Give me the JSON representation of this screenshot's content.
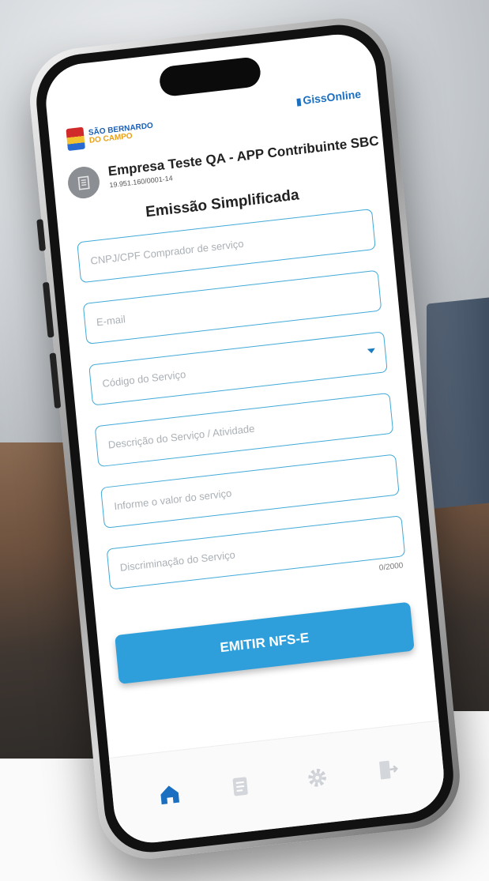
{
  "header": {
    "city_logo": {
      "line1": "SÃO BERNARDO",
      "line2": "DO CAMPO"
    },
    "app_logo": "GissOnline"
  },
  "company": {
    "name": "Empresa Teste QA - APP Contribuinte SBC",
    "document": "19.951.160/0001-14"
  },
  "form": {
    "title": "Emissão Simplificada",
    "fields": [
      {
        "placeholder": "CNPJ/CPF Comprador de serviço"
      },
      {
        "placeholder": "E-mail"
      },
      {
        "placeholder": "Código do Serviço",
        "type": "select"
      },
      {
        "placeholder": "Descrição do Serviço / Atividade"
      },
      {
        "placeholder": "Informe o valor do serviço"
      },
      {
        "placeholder": "Discriminação do Serviço",
        "counter": "0/2000"
      }
    ],
    "submit_label": "EMITIR NFS-E"
  },
  "bottom_nav": {
    "items": [
      {
        "icon": "home-icon",
        "active": true
      },
      {
        "icon": "document-icon",
        "active": false
      },
      {
        "icon": "gear-icon",
        "active": false
      },
      {
        "icon": "logout-icon",
        "active": false
      }
    ]
  },
  "colors": {
    "accent": "#2e9fdb",
    "border": "#41a9d8",
    "active_icon": "#1a6fc0",
    "inactive_icon": "#c9ccd0"
  }
}
